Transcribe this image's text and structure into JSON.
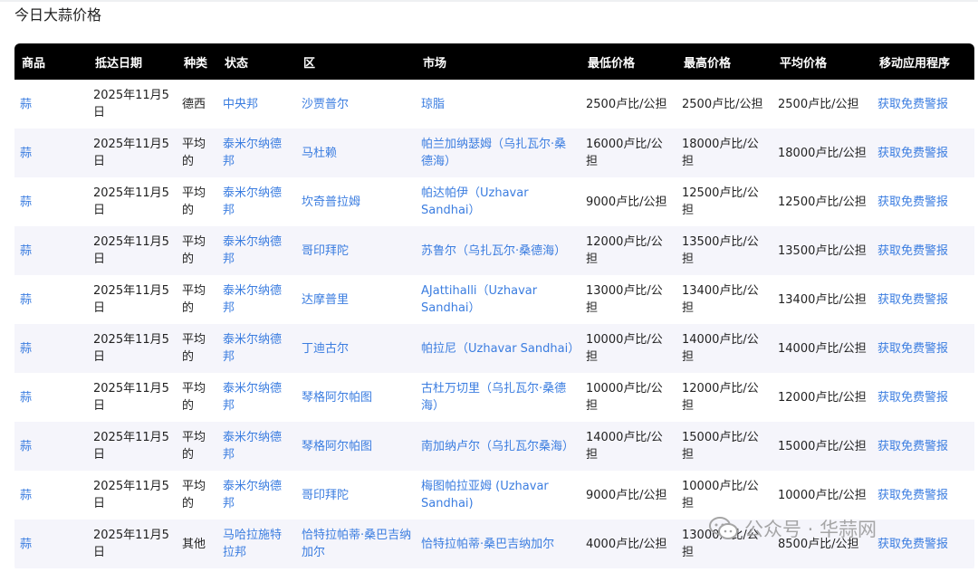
{
  "page_title": "今日大蒜价格",
  "table": {
    "headers": [
      "商品",
      "抵达日期",
      "种类",
      "状态",
      "区",
      "市场",
      "最低价格",
      "最高价格",
      "平均价格",
      "移动应用程序"
    ],
    "rows": [
      {
        "commodity": "蒜",
        "date": "2025年11月5日",
        "variety": "德西",
        "state": "中央邦",
        "district": "沙贾普尔",
        "market": "琼脂",
        "min": "2500卢比/公担",
        "max": "2500卢比/公担",
        "avg": "2500卢比/公担",
        "app": "获取免费警报"
      },
      {
        "commodity": "蒜",
        "date": "2025年11月5日",
        "variety": "平均的",
        "state": "泰米尔纳德邦",
        "district": "马杜赖",
        "market": "帕兰加纳瑟姆（乌扎瓦尔·桑德海）",
        "min": "16000卢比/公担",
        "max": "18000卢比/公担",
        "avg": "18000卢比/公担",
        "app": "获取免费警报"
      },
      {
        "commodity": "蒜",
        "date": "2025年11月5日",
        "variety": "平均的",
        "state": "泰米尔纳德邦",
        "district": "坎奇普拉姆",
        "market": "帕达帕伊（Uzhavar Sandhai）",
        "min": "9000卢比/公担",
        "max": "12500卢比/公担",
        "avg": "12500卢比/公担",
        "app": "获取免费警报"
      },
      {
        "commodity": "蒜",
        "date": "2025年11月5日",
        "variety": "平均的",
        "state": "泰米尔纳德邦",
        "district": "哥印拜陀",
        "market": "苏鲁尔（乌扎瓦尔·桑德海）",
        "min": "12000卢比/公担",
        "max": "13500卢比/公担",
        "avg": "13500卢比/公担",
        "app": "获取免费警报"
      },
      {
        "commodity": "蒜",
        "date": "2025年11月5日",
        "variety": "平均的",
        "state": "泰米尔纳德邦",
        "district": "达摩普里",
        "market": "AJattihalli（Uzhavar Sandhai）",
        "min": "13000卢比/公担",
        "max": "13400卢比/公担",
        "avg": "13400卢比/公担",
        "app": "获取免费警报"
      },
      {
        "commodity": "蒜",
        "date": "2025年11月5日",
        "variety": "平均的",
        "state": "泰米尔纳德邦",
        "district": "丁迪古尔",
        "market": "帕拉尼（Uzhavar Sandhai）",
        "min": "10000卢比/公担",
        "max": "14000卢比/公担",
        "avg": "14000卢比/公担",
        "app": "获取免费警报"
      },
      {
        "commodity": "蒜",
        "date": "2025年11月5日",
        "variety": "平均的",
        "state": "泰米尔纳德邦",
        "district": "琴格阿尔帕图",
        "market": "古杜万切里（乌扎瓦尔·桑德海）",
        "min": "10000卢比/公担",
        "max": "12000卢比/公担",
        "avg": "12000卢比/公担",
        "app": "获取免费警报"
      },
      {
        "commodity": "蒜",
        "date": "2025年11月5日",
        "variety": "平均的",
        "state": "泰米尔纳德邦",
        "district": "琴格阿尔帕图",
        "market": "南加纳卢尔（乌扎瓦尔桑海）",
        "min": "14000卢比/公担",
        "max": "15000卢比/公担",
        "avg": "15000卢比/公担",
        "app": "获取免费警报"
      },
      {
        "commodity": "蒜",
        "date": "2025年11月5日",
        "variety": "平均的",
        "state": "泰米尔纳德邦",
        "district": "哥印拜陀",
        "market": "梅图帕拉亚姆 (Uzhavar Sandhai)",
        "min": "9000卢比/公担",
        "max": "10000卢比/公担",
        "avg": "10000卢比/公担",
        "app": "获取免费警报"
      },
      {
        "commodity": "蒜",
        "date": "2025年11月5日",
        "variety": "其他",
        "state": "马哈拉施特拉邦",
        "district": "恰特拉帕蒂·桑巴吉纳加尔",
        "market": "恰特拉帕蒂·桑巴吉纳加尔",
        "min": "4000卢比/公担",
        "max": "13000卢比/公担",
        "avg": "8500卢比/公担",
        "app": "获取免费警报"
      }
    ]
  },
  "watermark": {
    "text": "公众号 · 华蒜网",
    "icon": "wechat-icon"
  },
  "colors": {
    "header_bg": "#000000",
    "header_text": "#ffffff",
    "link": "#3b7de0",
    "row_alt": "#f5f5fb"
  }
}
